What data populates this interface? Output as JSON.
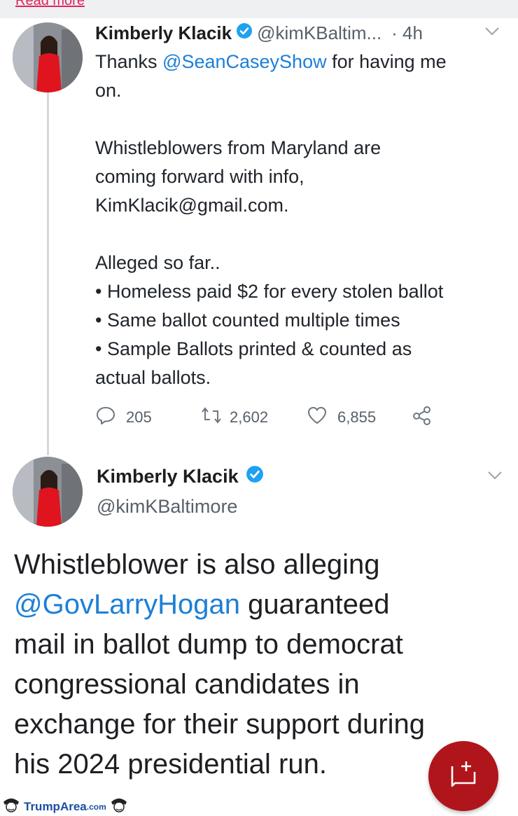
{
  "header": {
    "read_more_label": "Read more"
  },
  "tweet1": {
    "author_name": "Kimberly Klacik",
    "handle": "@kimKBaltim...",
    "time": "· 4h",
    "line1_prefix": "Thanks ",
    "line1_mention": "@SeanCaseyShow",
    "line1_suffix": " for having me",
    "line2": "on.",
    "line3": "Whistleblowers from Maryland are",
    "line4": "coming forward with info,",
    "line5": "KimKlacik@gmail.com.",
    "line6": "Alleged so far..",
    "bullet1": "• Homeless paid $2 for every stolen ballot",
    "bullet2": "• Same ballot counted multiple times",
    "bullet3": "• Sample Ballots printed & counted as",
    "line7": "actual ballots.",
    "replies": "205",
    "retweets": "2,602",
    "likes": "6,855"
  },
  "tweet2": {
    "author_name": "Kimberly Klacik",
    "handle": "@kimKBaltimore",
    "line1": "Whistleblower is also alleging",
    "line2_mention": "@GovLarryHogan",
    "line2_suffix": " guaranteed",
    "line3": "mail in ballot dump to democrat",
    "line4": "congressional candidates in",
    "line5": "exchange for their support during",
    "line6": "his 2024 presidential run."
  },
  "watermark": {
    "brand": "TrumpArea",
    "suffix": ".com"
  },
  "icons": {
    "reply": "reply-icon",
    "retweet": "retweet-icon",
    "like": "heart-icon",
    "share": "share-icon",
    "verified": "verified-badge-icon",
    "compose": "compose-icon",
    "more": "chevron-down-icon"
  },
  "colors": {
    "mention": "#1d7fd6",
    "verified": "#1da1f2",
    "fab": "#b0151b",
    "avatar_dress": "#e0141e"
  }
}
